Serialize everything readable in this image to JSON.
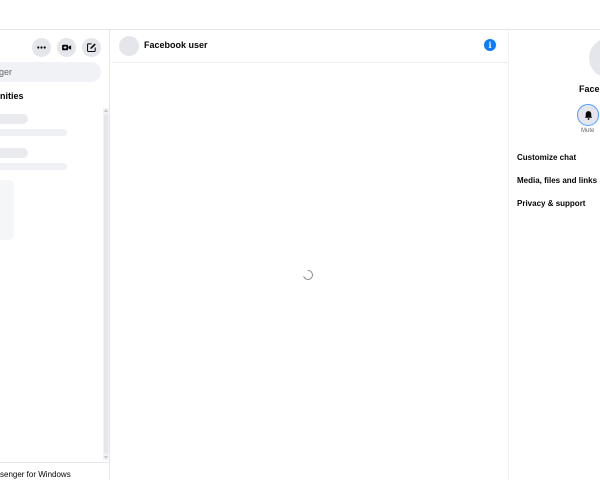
{
  "sidebar": {
    "search_placeholder": "ger",
    "section_label": "nities",
    "footer_link": "senger for Windows"
  },
  "chat": {
    "contact_name": "Facebook user",
    "info_icon_glyph": "i"
  },
  "info_panel": {
    "profile_name": "Faceb",
    "mute_label": "Mute",
    "menu_items": [
      "Customize chat",
      "Media, files and links",
      "Privacy & support"
    ]
  },
  "colors": {
    "accent": "#0a7cff",
    "skeleton": "#e9ebee",
    "button_bg": "#e4e6eb",
    "divider": "#e4e6eb"
  },
  "icons": {
    "more": "more-dots-icon",
    "video": "video-camera-icon",
    "compose": "compose-icon",
    "info": "info-icon",
    "bell": "bell-icon",
    "spinner": "loading-spinner-icon"
  }
}
